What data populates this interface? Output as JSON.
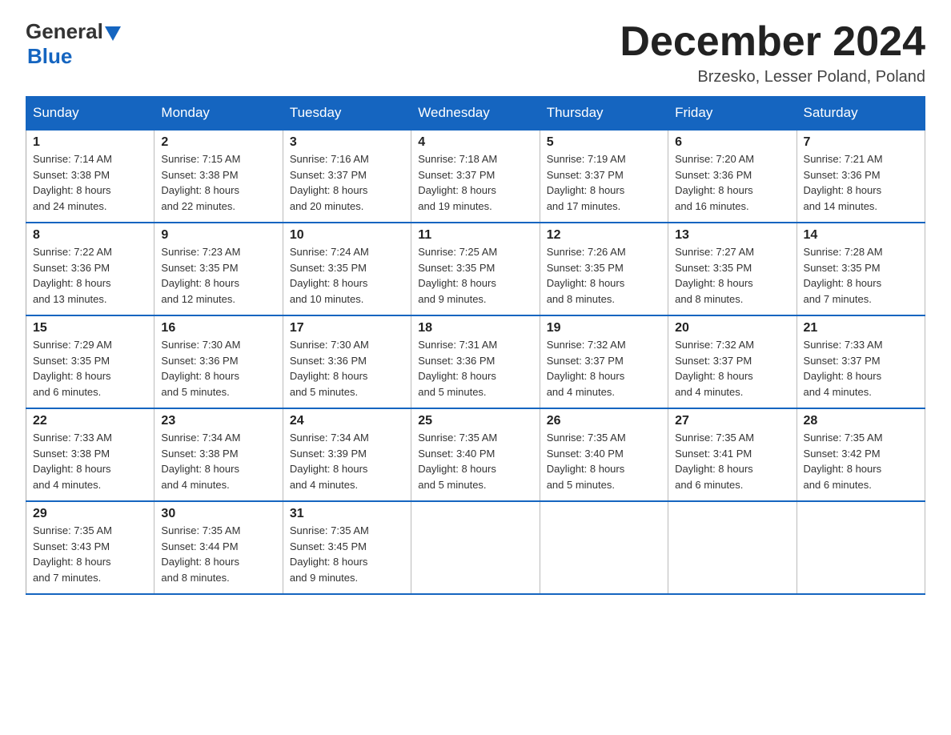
{
  "logo": {
    "text_general": "General",
    "text_blue": "Blue"
  },
  "title": "December 2024",
  "location": "Brzesko, Lesser Poland, Poland",
  "days_of_week": [
    "Sunday",
    "Monday",
    "Tuesday",
    "Wednesday",
    "Thursday",
    "Friday",
    "Saturday"
  ],
  "weeks": [
    [
      {
        "day": "1",
        "info": "Sunrise: 7:14 AM\nSunset: 3:38 PM\nDaylight: 8 hours\nand 24 minutes."
      },
      {
        "day": "2",
        "info": "Sunrise: 7:15 AM\nSunset: 3:38 PM\nDaylight: 8 hours\nand 22 minutes."
      },
      {
        "day": "3",
        "info": "Sunrise: 7:16 AM\nSunset: 3:37 PM\nDaylight: 8 hours\nand 20 minutes."
      },
      {
        "day": "4",
        "info": "Sunrise: 7:18 AM\nSunset: 3:37 PM\nDaylight: 8 hours\nand 19 minutes."
      },
      {
        "day": "5",
        "info": "Sunrise: 7:19 AM\nSunset: 3:37 PM\nDaylight: 8 hours\nand 17 minutes."
      },
      {
        "day": "6",
        "info": "Sunrise: 7:20 AM\nSunset: 3:36 PM\nDaylight: 8 hours\nand 16 minutes."
      },
      {
        "day": "7",
        "info": "Sunrise: 7:21 AM\nSunset: 3:36 PM\nDaylight: 8 hours\nand 14 minutes."
      }
    ],
    [
      {
        "day": "8",
        "info": "Sunrise: 7:22 AM\nSunset: 3:36 PM\nDaylight: 8 hours\nand 13 minutes."
      },
      {
        "day": "9",
        "info": "Sunrise: 7:23 AM\nSunset: 3:35 PM\nDaylight: 8 hours\nand 12 minutes."
      },
      {
        "day": "10",
        "info": "Sunrise: 7:24 AM\nSunset: 3:35 PM\nDaylight: 8 hours\nand 10 minutes."
      },
      {
        "day": "11",
        "info": "Sunrise: 7:25 AM\nSunset: 3:35 PM\nDaylight: 8 hours\nand 9 minutes."
      },
      {
        "day": "12",
        "info": "Sunrise: 7:26 AM\nSunset: 3:35 PM\nDaylight: 8 hours\nand 8 minutes."
      },
      {
        "day": "13",
        "info": "Sunrise: 7:27 AM\nSunset: 3:35 PM\nDaylight: 8 hours\nand 8 minutes."
      },
      {
        "day": "14",
        "info": "Sunrise: 7:28 AM\nSunset: 3:35 PM\nDaylight: 8 hours\nand 7 minutes."
      }
    ],
    [
      {
        "day": "15",
        "info": "Sunrise: 7:29 AM\nSunset: 3:35 PM\nDaylight: 8 hours\nand 6 minutes."
      },
      {
        "day": "16",
        "info": "Sunrise: 7:30 AM\nSunset: 3:36 PM\nDaylight: 8 hours\nand 5 minutes."
      },
      {
        "day": "17",
        "info": "Sunrise: 7:30 AM\nSunset: 3:36 PM\nDaylight: 8 hours\nand 5 minutes."
      },
      {
        "day": "18",
        "info": "Sunrise: 7:31 AM\nSunset: 3:36 PM\nDaylight: 8 hours\nand 5 minutes."
      },
      {
        "day": "19",
        "info": "Sunrise: 7:32 AM\nSunset: 3:37 PM\nDaylight: 8 hours\nand 4 minutes."
      },
      {
        "day": "20",
        "info": "Sunrise: 7:32 AM\nSunset: 3:37 PM\nDaylight: 8 hours\nand 4 minutes."
      },
      {
        "day": "21",
        "info": "Sunrise: 7:33 AM\nSunset: 3:37 PM\nDaylight: 8 hours\nand 4 minutes."
      }
    ],
    [
      {
        "day": "22",
        "info": "Sunrise: 7:33 AM\nSunset: 3:38 PM\nDaylight: 8 hours\nand 4 minutes."
      },
      {
        "day": "23",
        "info": "Sunrise: 7:34 AM\nSunset: 3:38 PM\nDaylight: 8 hours\nand 4 minutes."
      },
      {
        "day": "24",
        "info": "Sunrise: 7:34 AM\nSunset: 3:39 PM\nDaylight: 8 hours\nand 4 minutes."
      },
      {
        "day": "25",
        "info": "Sunrise: 7:35 AM\nSunset: 3:40 PM\nDaylight: 8 hours\nand 5 minutes."
      },
      {
        "day": "26",
        "info": "Sunrise: 7:35 AM\nSunset: 3:40 PM\nDaylight: 8 hours\nand 5 minutes."
      },
      {
        "day": "27",
        "info": "Sunrise: 7:35 AM\nSunset: 3:41 PM\nDaylight: 8 hours\nand 6 minutes."
      },
      {
        "day": "28",
        "info": "Sunrise: 7:35 AM\nSunset: 3:42 PM\nDaylight: 8 hours\nand 6 minutes."
      }
    ],
    [
      {
        "day": "29",
        "info": "Sunrise: 7:35 AM\nSunset: 3:43 PM\nDaylight: 8 hours\nand 7 minutes."
      },
      {
        "day": "30",
        "info": "Sunrise: 7:35 AM\nSunset: 3:44 PM\nDaylight: 8 hours\nand 8 minutes."
      },
      {
        "day": "31",
        "info": "Sunrise: 7:35 AM\nSunset: 3:45 PM\nDaylight: 8 hours\nand 9 minutes."
      },
      null,
      null,
      null,
      null
    ]
  ]
}
